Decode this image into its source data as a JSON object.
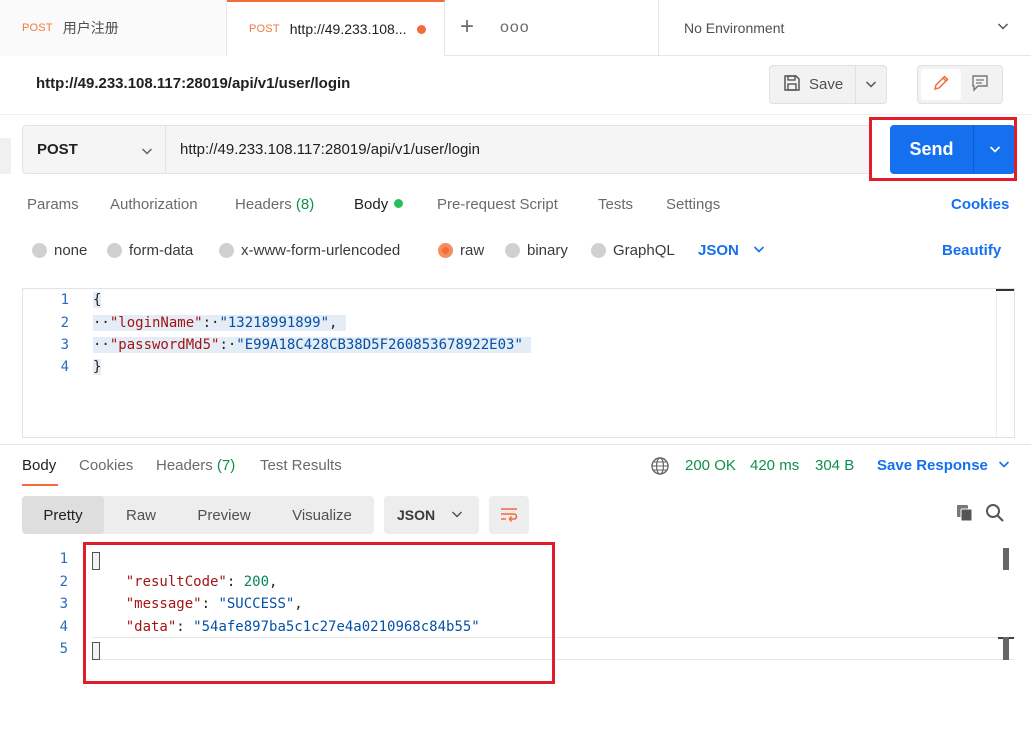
{
  "tabs": [
    {
      "method": "POST",
      "title": "用户注册"
    },
    {
      "method": "POST",
      "title": "http://49.233.108..."
    }
  ],
  "tab_actions": {
    "add": "+",
    "more": "ooo"
  },
  "environment": {
    "label": "No Environment"
  },
  "request": {
    "title": "http://49.233.108.117:28019/api/v1/user/login",
    "save_label": "Save",
    "method": "POST",
    "url": "http://49.233.108.117:28019/api/v1/user/login",
    "send_label": "Send"
  },
  "request_tabs": {
    "params": "Params",
    "authorization": "Authorization",
    "headers": "Headers",
    "headers_count": "(8)",
    "body": "Body",
    "prerequest": "Pre-request Script",
    "tests": "Tests",
    "settings": "Settings",
    "cookies": "Cookies"
  },
  "body_types": {
    "none": "none",
    "form_data": "form-data",
    "urlencoded": "x-www-form-urlencoded",
    "raw": "raw",
    "binary": "binary",
    "graphql": "GraphQL",
    "selected": "raw",
    "format": "JSON",
    "beautify": "Beautify"
  },
  "request_body": {
    "line_numbers": [
      "1",
      "2",
      "3",
      "4"
    ],
    "open": "{",
    "close": "}",
    "lines": [
      {
        "key": "\"loginName\"",
        "value": "\"13218991899\"",
        "trail": ","
      },
      {
        "key": "\"passwordMd5\"",
        "value": "\"E99A18C428CB38D5F260853678922E03\"",
        "trail": ""
      }
    ]
  },
  "response_tabs": {
    "body": "Body",
    "cookies": "Cookies",
    "headers": "Headers",
    "headers_count": "(7)",
    "test_results": "Test Results"
  },
  "response_status": {
    "status": "200 OK",
    "time": "420 ms",
    "size": "304 B",
    "save_response": "Save Response"
  },
  "response_view": {
    "pretty": "Pretty",
    "raw": "Raw",
    "preview": "Preview",
    "visualize": "Visualize",
    "format": "JSON"
  },
  "response_body": {
    "line_numbers": [
      "1",
      "2",
      "3",
      "4",
      "5"
    ],
    "open": "{",
    "close": "}",
    "lines": [
      {
        "key": "\"resultCode\"",
        "value": "200",
        "value_type": "number",
        "trail": ","
      },
      {
        "key": "\"message\"",
        "value": "\"SUCCESS\"",
        "value_type": "string",
        "trail": ","
      },
      {
        "key": "\"data\"",
        "value": "\"54afe897ba5c1c27e4a0210968c84b55\"",
        "value_type": "string",
        "trail": ""
      }
    ]
  },
  "colors": {
    "accent": "#1570ef",
    "method_post": "#ef7a3c",
    "status_ok": "#0f8f4c",
    "annotation": "#e11d2a"
  }
}
